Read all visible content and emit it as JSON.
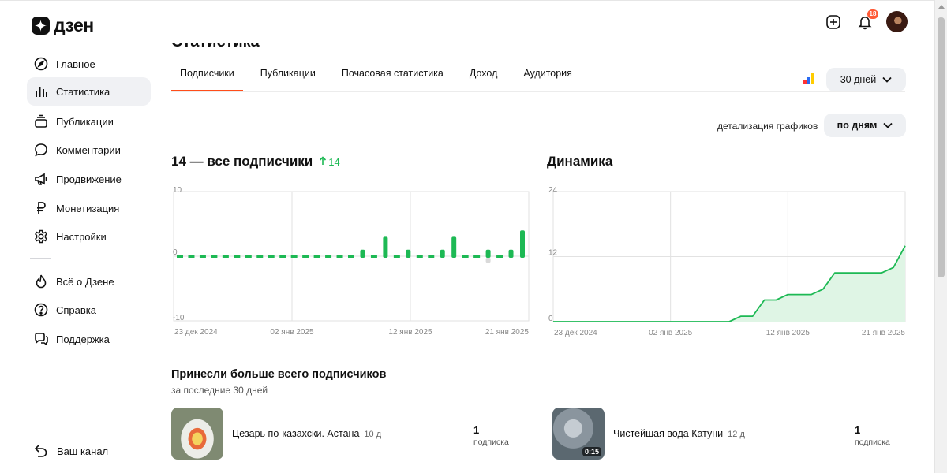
{
  "logo": {
    "text": "дзен"
  },
  "sidebar": {
    "items": [
      {
        "label": "Главное",
        "icon": "compass-icon",
        "active": false
      },
      {
        "label": "Статистика",
        "icon": "bar-chart-icon",
        "active": true
      },
      {
        "label": "Публикации",
        "icon": "stack-icon",
        "active": false
      },
      {
        "label": "Комментарии",
        "icon": "comment-icon",
        "active": false
      },
      {
        "label": "Продвижение",
        "icon": "megaphone-icon",
        "active": false
      },
      {
        "label": "Монетизация",
        "icon": "ruble-icon",
        "active": false
      },
      {
        "label": "Настройки",
        "icon": "gear-icon",
        "active": false
      },
      {
        "label": "Всё о Дзене",
        "icon": "flame-icon",
        "active": false
      },
      {
        "label": "Справка",
        "icon": "help-icon",
        "active": false
      },
      {
        "label": "Поддержка",
        "icon": "chat-icon",
        "active": false
      }
    ],
    "channel_link": "Ваш канал"
  },
  "header": {
    "notifications_count": "18"
  },
  "page": {
    "title": "Статистика",
    "tabs": [
      {
        "label": "Подписчики",
        "active": true
      },
      {
        "label": "Публикации",
        "active": false
      },
      {
        "label": "Почасовая статистика",
        "active": false
      },
      {
        "label": "Доход",
        "active": false
      },
      {
        "label": "Аудитория",
        "active": false
      }
    ],
    "period_label": "30 дней",
    "detail_label": "детализация графиков",
    "detail_value": "по дням"
  },
  "colors": {
    "accent": "#ff4d1a",
    "positive": "#1db954",
    "area_fill": "#dff5e5",
    "grid": "#e2e2e2",
    "zero_dash": "#c8c8c8",
    "negative": "#d9d9d9"
  },
  "chart_data": [
    {
      "type": "bar",
      "title": "14 — все подписчики",
      "title_growth": "14",
      "ylim": [
        -10,
        10
      ],
      "y_ticks": [
        "10",
        "0",
        "-10"
      ],
      "x_tick_labels": [
        "23 дек 2024",
        "02 янв 2025",
        "12 янв 2025",
        "21 янв 2025"
      ],
      "grid": true,
      "positive": [
        0,
        0,
        0,
        0,
        0,
        0,
        0,
        0,
        0,
        0,
        0,
        0,
        0,
        0,
        0,
        0,
        1,
        0,
        3,
        0,
        1,
        0,
        0,
        1,
        3,
        0,
        0,
        1,
        0,
        1,
        4
      ],
      "negative": [
        0,
        0,
        0,
        0,
        0,
        0,
        0,
        0,
        0,
        0,
        0,
        0,
        0,
        0,
        0,
        0,
        0,
        0,
        0,
        0,
        0,
        0,
        0,
        0,
        0,
        0,
        0,
        -1,
        0,
        0,
        0
      ]
    },
    {
      "type": "area",
      "title": "Динамика",
      "ylim": [
        0,
        24
      ],
      "y_ticks": [
        "24",
        "12",
        "0"
      ],
      "x_tick_labels": [
        "23 дек 2024",
        "02 янв 2025",
        "12 янв 2025",
        "21 янв 2025"
      ],
      "grid": true,
      "values": [
        0,
        0,
        0,
        0,
        0,
        0,
        0,
        0,
        0,
        0,
        0,
        0,
        0,
        0,
        0,
        0,
        1,
        1,
        4,
        4,
        5,
        5,
        5,
        6,
        9,
        9,
        9,
        9,
        9,
        10,
        14
      ]
    }
  ],
  "top_publications": {
    "title": "Принесли больше всего подписчиков",
    "subtitle": "за последние 30 дней",
    "items": [
      {
        "title": "Цезарь по-казахски. Астана",
        "age": "10 д",
        "count": "1",
        "count_label": "подписка",
        "duration": ""
      },
      {
        "title": "Чистейшая вода Катуни",
        "age": "12 д",
        "count": "1",
        "count_label": "подписка",
        "duration": "0:15"
      }
    ]
  }
}
